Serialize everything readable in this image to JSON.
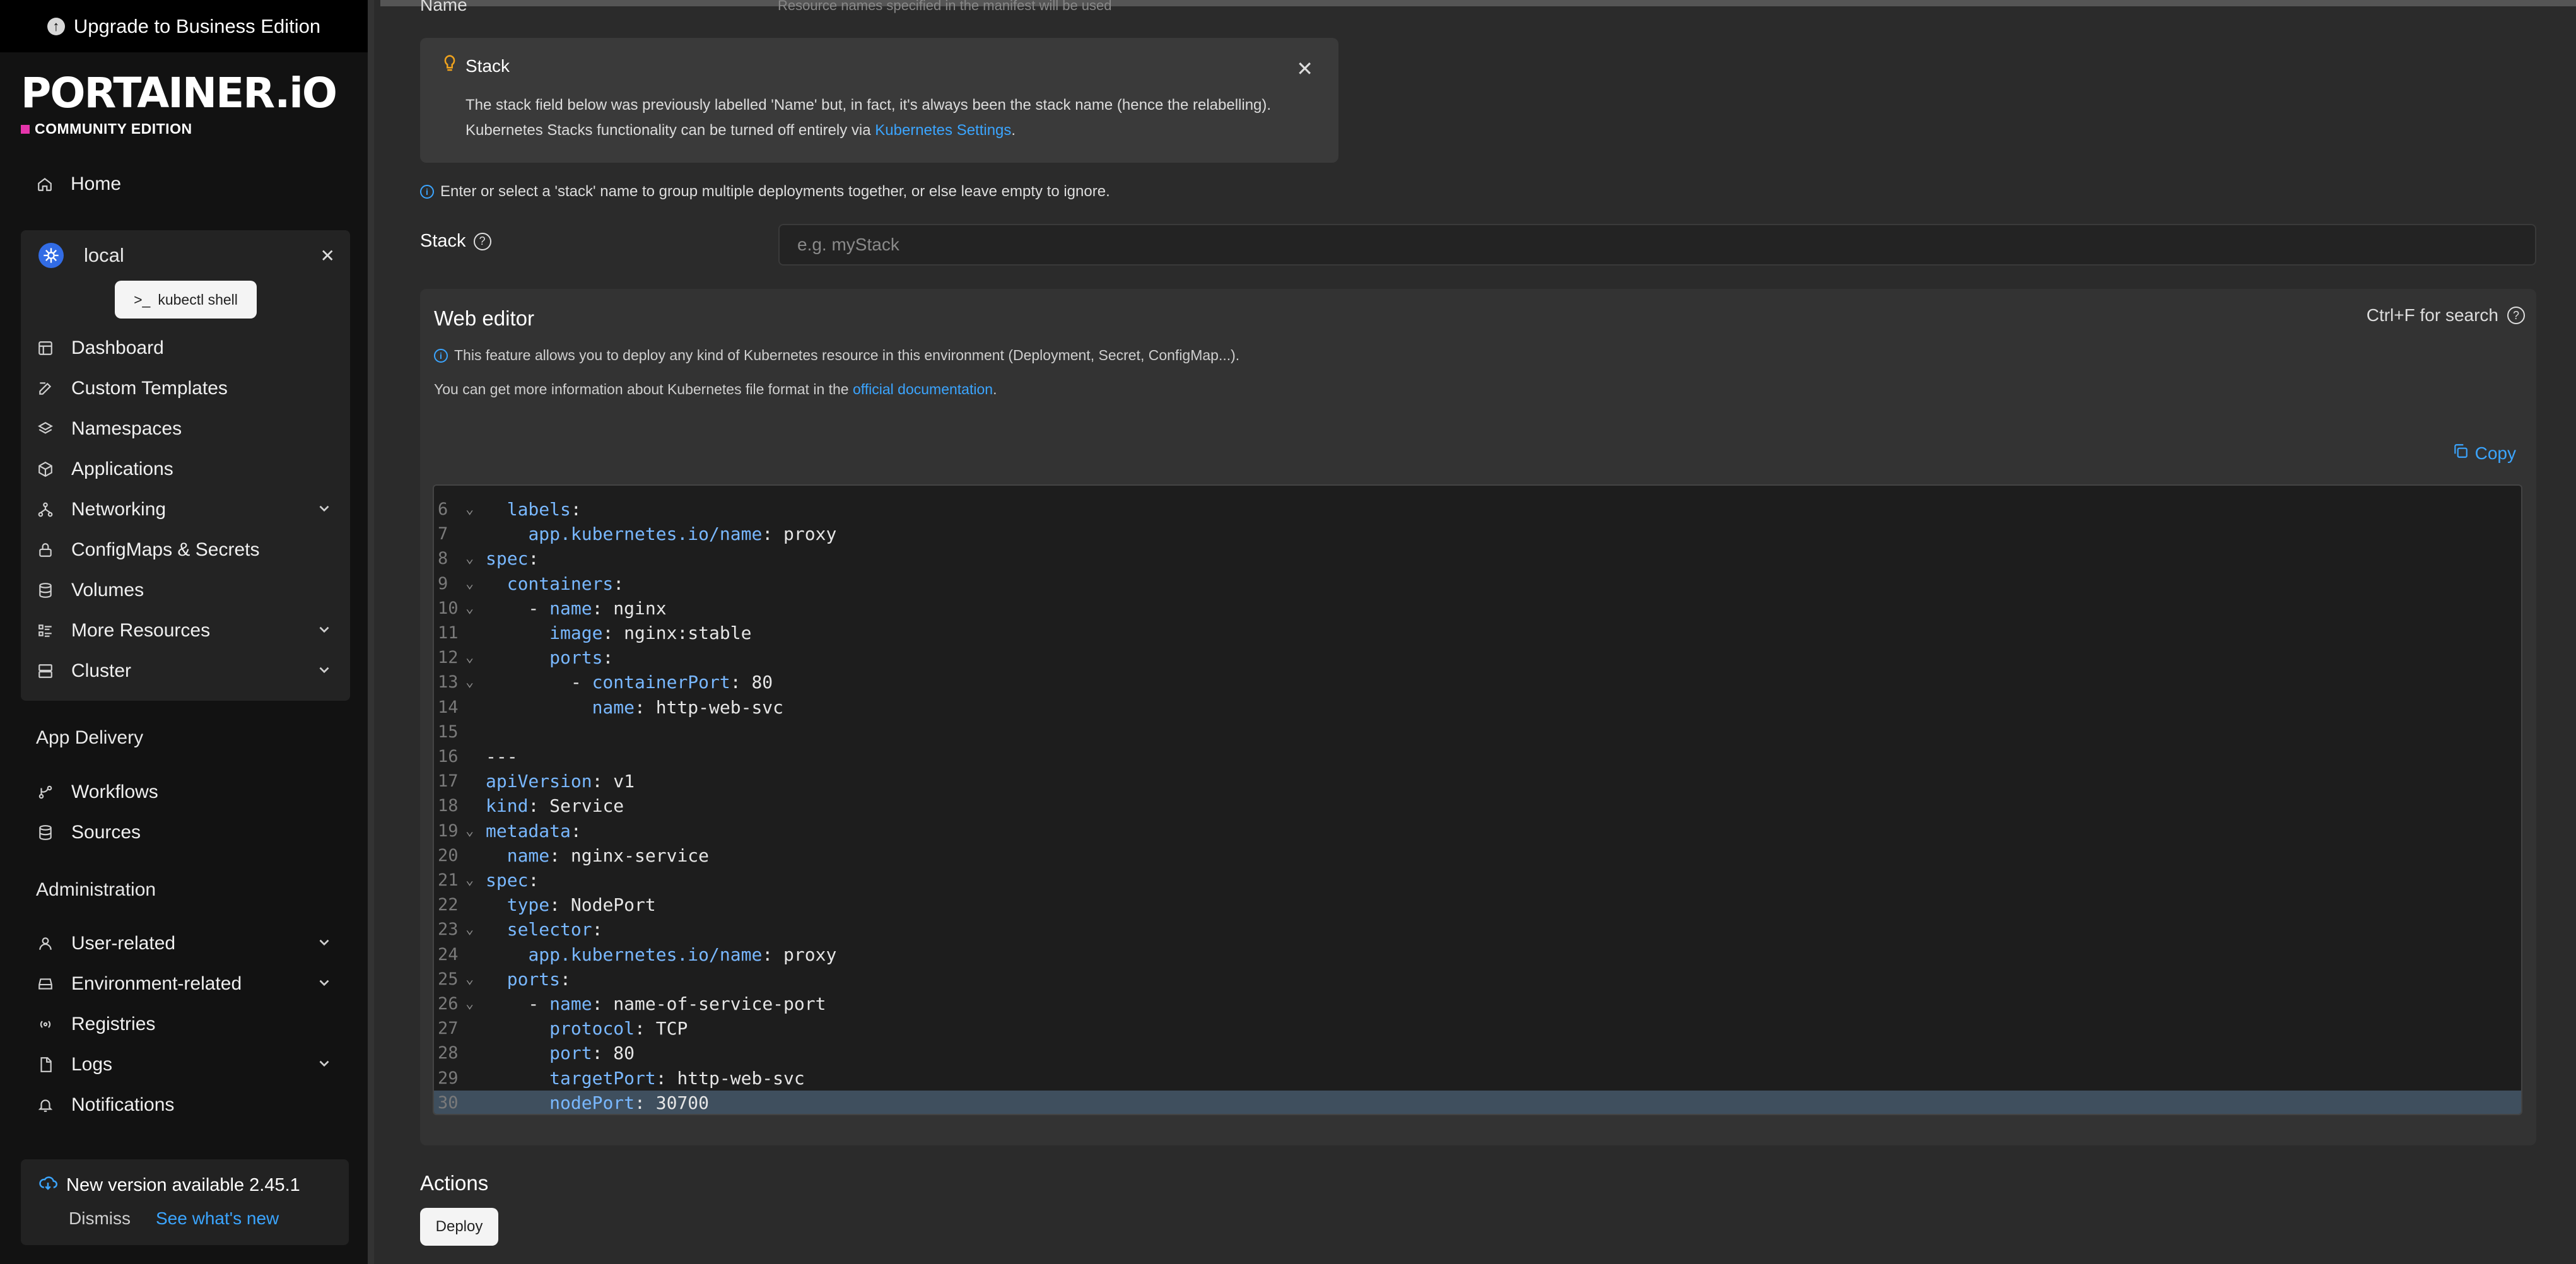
{
  "sidebar": {
    "upgrade_label": "Upgrade to Business Edition",
    "logo_text": "PORTAINER.iO",
    "logo_sub": "COMMUNITY EDITION",
    "home": "Home",
    "environment": {
      "name": "local",
      "kubectl_label": "kubectl shell",
      "items": [
        "Dashboard",
        "Custom Templates",
        "Namespaces",
        "Applications",
        "Networking",
        "ConfigMaps & Secrets",
        "Volumes",
        "More Resources",
        "Cluster"
      ]
    },
    "app_delivery_title": "App Delivery",
    "app_delivery_items": [
      "Workflows",
      "Sources"
    ],
    "administration_title": "Administration",
    "administration_items": [
      "User-related",
      "Environment-related",
      "Registries",
      "Logs",
      "Notifications"
    ],
    "update": {
      "title": "New version available 2.45.1",
      "dismiss": "Dismiss",
      "whats_new": "See what's new"
    }
  },
  "main": {
    "name_label": "Name",
    "name_hint": "Resource names specified in the manifest will be used",
    "stack_alert": {
      "title": "Stack",
      "line1": "The stack field below was previously labelled 'Name' but, in fact, it's always been the stack name (hence the relabelling).",
      "line2_prefix": "Kubernetes Stacks functionality can be turned off entirely via ",
      "line2_link": "Kubernetes Settings",
      "line2_suffix": "."
    },
    "stack_info": "Enter or select a 'stack' name to group multiple deployments together, or else leave empty to ignore.",
    "stack_label": "Stack",
    "stack_placeholder": "e.g. myStack",
    "web_editor": {
      "title": "Web editor",
      "search_hint": "Ctrl+F for search",
      "info": "This feature allows you to deploy any kind of Kubernetes resource in this environment (Deployment, Secret, ConfigMap...).",
      "doc_prefix": "You can get more information about Kubernetes file format in the ",
      "doc_link": "official documentation",
      "doc_suffix": ".",
      "copy_label": "Copy",
      "code_lines": [
        {
          "n": "6",
          "fold": true,
          "indent": "  ",
          "key": "labels",
          "value": ""
        },
        {
          "n": "7",
          "fold": false,
          "indent": "    ",
          "key": "app.kubernetes.io/name",
          "value": " proxy"
        },
        {
          "n": "8",
          "fold": true,
          "indent": "",
          "key": "spec",
          "value": ""
        },
        {
          "n": "9",
          "fold": true,
          "indent": "  ",
          "key": "containers",
          "value": ""
        },
        {
          "n": "10",
          "fold": true,
          "indent": "    - ",
          "key": "name",
          "value": " nginx"
        },
        {
          "n": "11",
          "fold": false,
          "indent": "      ",
          "key": "image",
          "value": " nginx:stable"
        },
        {
          "n": "12",
          "fold": true,
          "indent": "      ",
          "key": "ports",
          "value": ""
        },
        {
          "n": "13",
          "fold": true,
          "indent": "        - ",
          "key": "containerPort",
          "value": " 80"
        },
        {
          "n": "14",
          "fold": false,
          "indent": "          ",
          "key": "name",
          "value": " http-web-svc"
        },
        {
          "n": "15",
          "fold": false,
          "indent": "",
          "key": "",
          "value": ""
        },
        {
          "n": "16",
          "fold": false,
          "indent": "",
          "key": "",
          "value": "---"
        },
        {
          "n": "17",
          "fold": false,
          "indent": "",
          "key": "apiVersion",
          "value": " v1"
        },
        {
          "n": "18",
          "fold": false,
          "indent": "",
          "key": "kind",
          "value": " Service"
        },
        {
          "n": "19",
          "fold": true,
          "indent": "",
          "key": "metadata",
          "value": ""
        },
        {
          "n": "20",
          "fold": false,
          "indent": "  ",
          "key": "name",
          "value": " nginx-service"
        },
        {
          "n": "21",
          "fold": true,
          "indent": "",
          "key": "spec",
          "value": ""
        },
        {
          "n": "22",
          "fold": false,
          "indent": "  ",
          "key": "type",
          "value": " NodePort"
        },
        {
          "n": "23",
          "fold": true,
          "indent": "  ",
          "key": "selector",
          "value": ""
        },
        {
          "n": "24",
          "fold": false,
          "indent": "    ",
          "key": "app.kubernetes.io/name",
          "value": " proxy"
        },
        {
          "n": "25",
          "fold": true,
          "indent": "  ",
          "key": "ports",
          "value": ""
        },
        {
          "n": "26",
          "fold": true,
          "indent": "    - ",
          "key": "name",
          "value": " name-of-service-port"
        },
        {
          "n": "27",
          "fold": false,
          "indent": "      ",
          "key": "protocol",
          "value": " TCP"
        },
        {
          "n": "28",
          "fold": false,
          "indent": "      ",
          "key": "port",
          "value": " 80"
        },
        {
          "n": "29",
          "fold": false,
          "indent": "      ",
          "key": "targetPort",
          "value": " http-web-svc"
        },
        {
          "n": "30",
          "fold": false,
          "indent": "      ",
          "key": "nodePort",
          "value": " 30700"
        }
      ],
      "active_line": "30"
    },
    "actions_title": "Actions",
    "deploy_label": "Deploy"
  },
  "colors": {
    "accent_link": "#3ba5ff",
    "kubernetes_blue": "#326ce5",
    "logo_magenta": "#e535ab"
  }
}
